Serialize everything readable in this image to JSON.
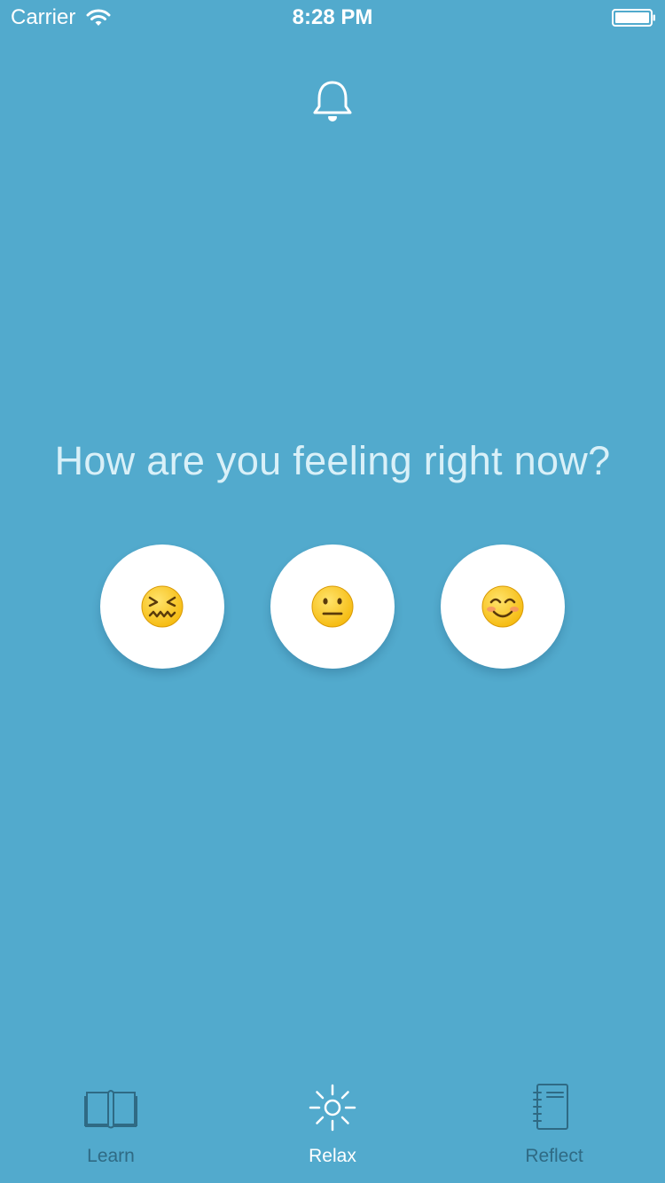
{
  "status_bar": {
    "carrier": "Carrier",
    "time": "8:28 PM"
  },
  "header": {
    "bell_icon": "bell-icon"
  },
  "main": {
    "prompt": "How are you feeling right now?",
    "moods": [
      {
        "icon": "confounded-face-emoji"
      },
      {
        "icon": "neutral-face-emoji"
      },
      {
        "icon": "smiling-face-emoji"
      }
    ]
  },
  "tabs": [
    {
      "label": "Learn",
      "icon": "book-icon",
      "active": false
    },
    {
      "label": "Relax",
      "icon": "sun-icon",
      "active": true
    },
    {
      "label": "Reflect",
      "icon": "notebook-icon",
      "active": false
    }
  ],
  "colors": {
    "background": "#52aacd",
    "prompt_text": "#d9f0f8",
    "inactive_tab": "#2f6a84",
    "active_tab": "#ffffff"
  }
}
